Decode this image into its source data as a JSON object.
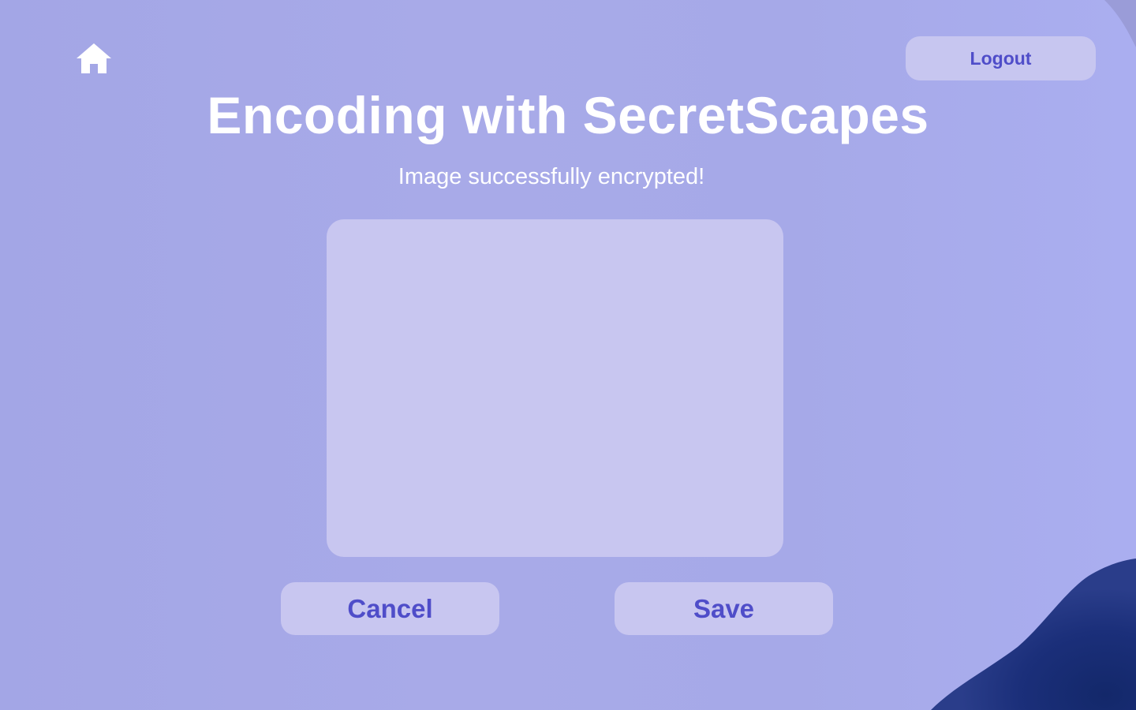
{
  "header": {
    "home_icon": "home-icon",
    "logout_label": "Logout"
  },
  "main": {
    "title": "Encoding with SecretScapes",
    "status": "Image successfully encrypted!"
  },
  "actions": {
    "cancel_label": "Cancel",
    "save_label": "Save"
  },
  "colors": {
    "background": "#a6a9e8",
    "button_bg": "#c8c6f0",
    "button_text": "#4f4dc9",
    "text": "#ffffff",
    "corner_accent": "#1a2a6e"
  }
}
